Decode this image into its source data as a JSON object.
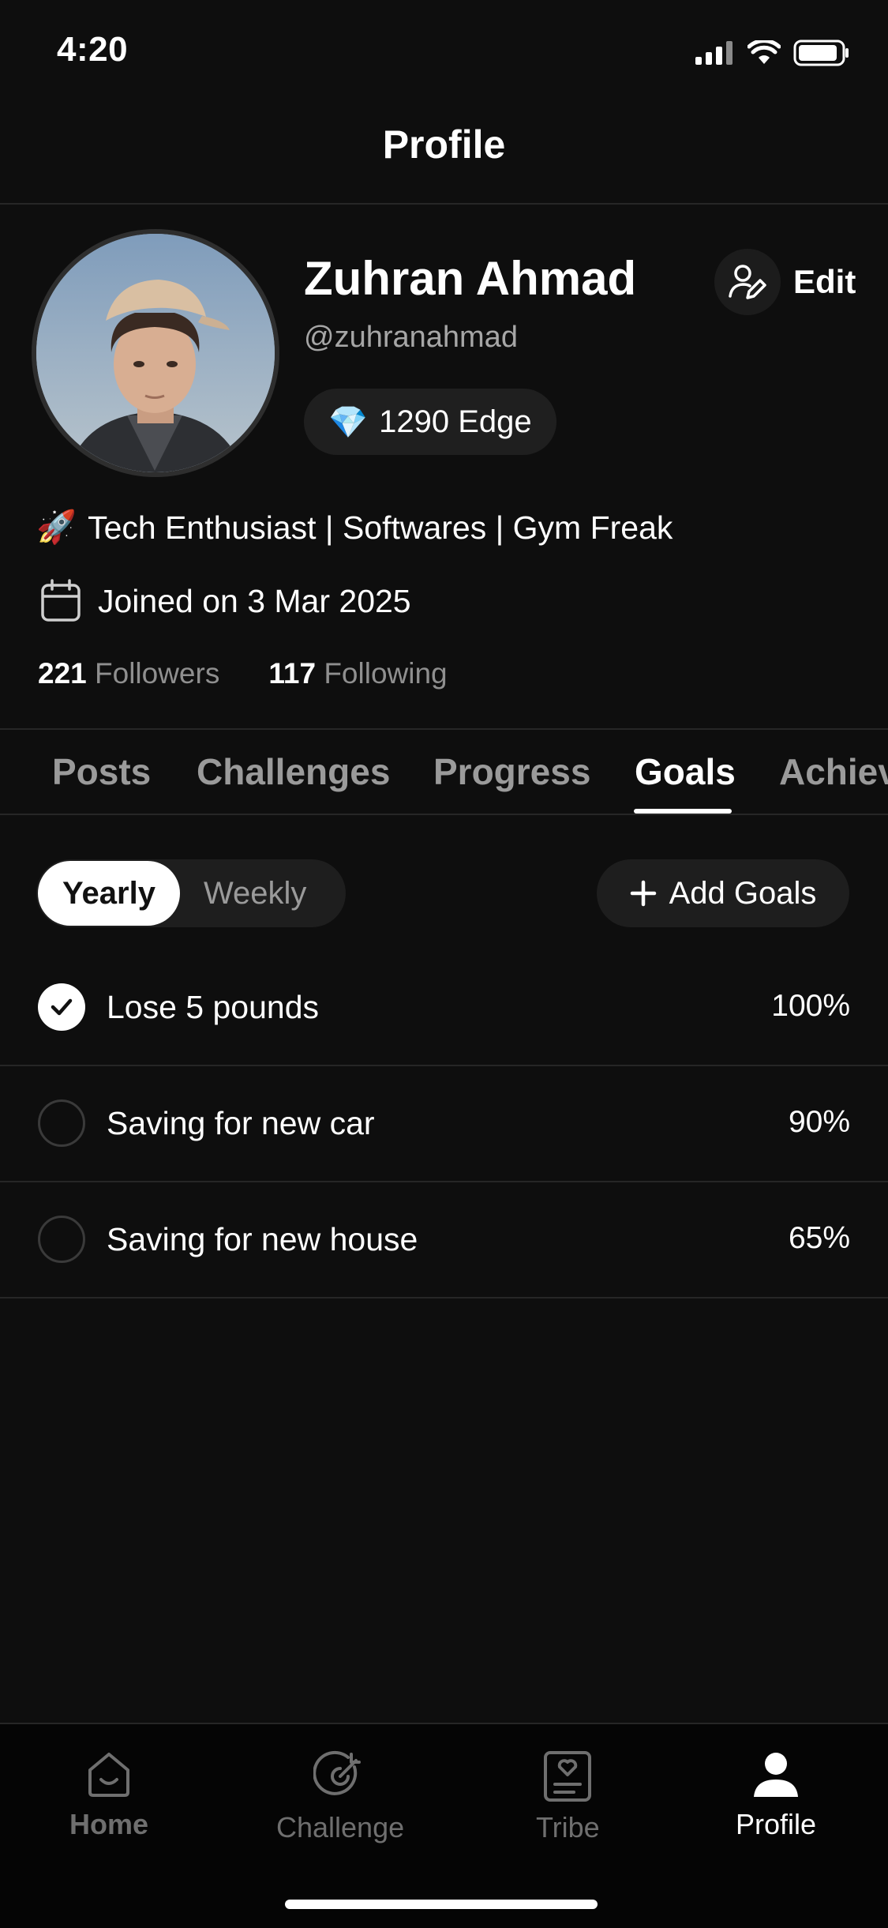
{
  "status_bar": {
    "time": "4:20"
  },
  "header": {
    "title": "Profile"
  },
  "profile": {
    "name": "Zuhran Ahmad",
    "handle": "@zuhranahmad",
    "edge_emoji": "💎",
    "edge_label": "1290 Edge",
    "edit_label": "Edit",
    "bio_emoji": "🚀",
    "bio": "Tech Enthusiast | Softwares | Gym Freak",
    "joined": "Joined on 3 Mar 2025",
    "followers_count": "221",
    "followers_label": "Followers",
    "following_count": "117",
    "following_label": "Following"
  },
  "tabs": [
    {
      "label": "Posts"
    },
    {
      "label": "Challenges"
    },
    {
      "label": "Progress"
    },
    {
      "label": "Goals",
      "active": true
    },
    {
      "label": "Achiev"
    }
  ],
  "goals_controls": {
    "yearly": "Yearly",
    "weekly": "Weekly",
    "add_goals": "Add Goals",
    "selected": "Yearly"
  },
  "goals": [
    {
      "title": "Lose 5 pounds",
      "percent": "100%",
      "done": true
    },
    {
      "title": "Saving for new car",
      "percent": "90%",
      "done": false
    },
    {
      "title": "Saving for new house",
      "percent": "65%",
      "done": false
    }
  ],
  "bottom_nav": [
    {
      "label": "Home",
      "icon": "home-icon"
    },
    {
      "label": "Challenge",
      "icon": "target-icon"
    },
    {
      "label": "Tribe",
      "icon": "tribe-icon"
    },
    {
      "label": "Profile",
      "icon": "person-icon",
      "active": true
    }
  ],
  "colors": {
    "background": "#0e0e0e",
    "surface": "#1e1e1e",
    "muted": "#9a9a9a",
    "accent": "#ffffff"
  }
}
